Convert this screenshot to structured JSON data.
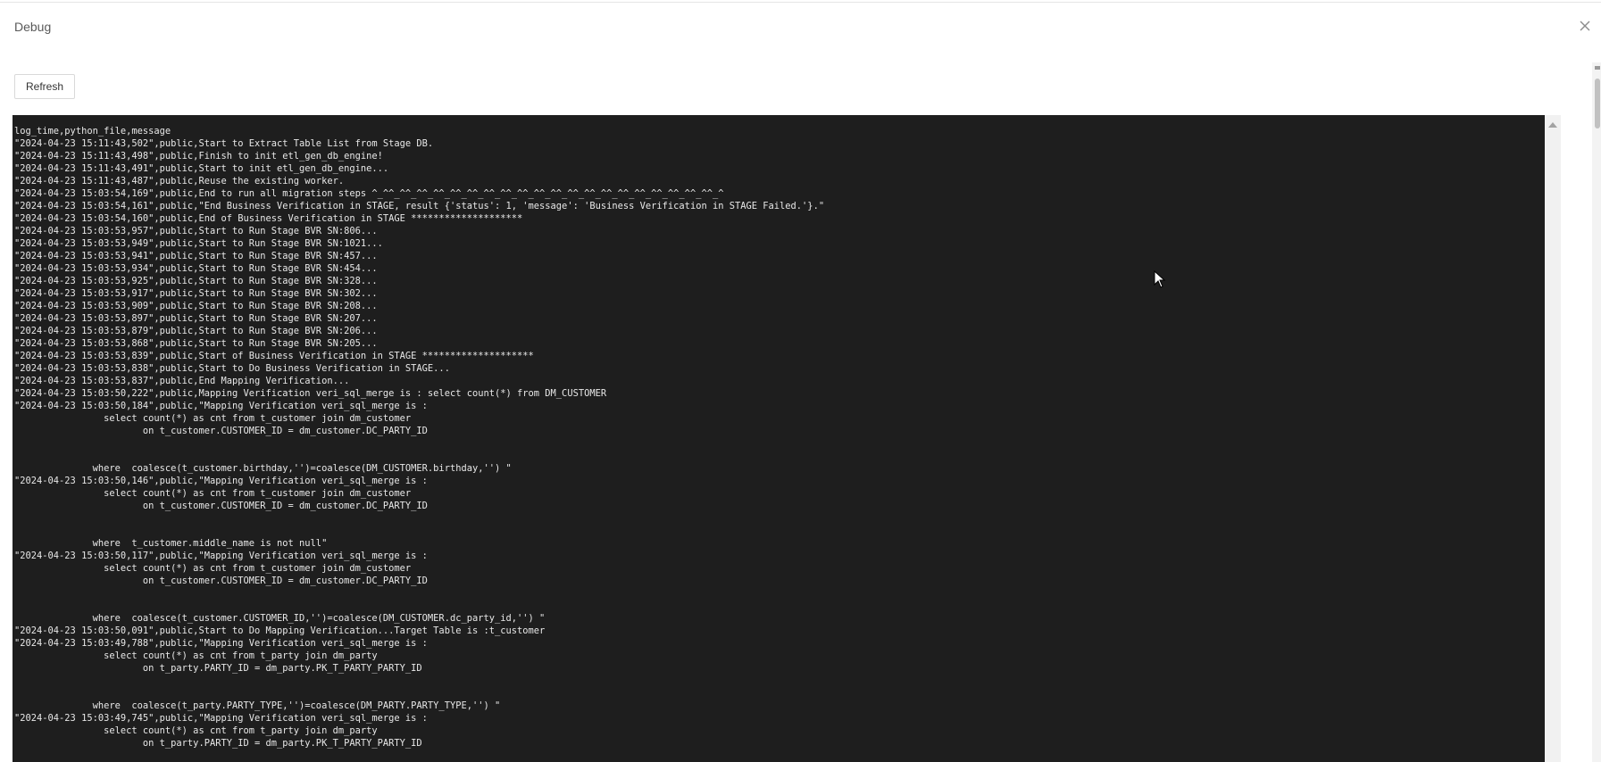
{
  "modal": {
    "title": "Debug",
    "close_icon": "close-icon",
    "refresh_label": "Refresh"
  },
  "log": {
    "lines": [
      "log_time,python_file,message",
      "\"2024-04-23 15:11:43,502\",public,Start to Extract Table List from Stage DB.",
      "\"2024-04-23 15:11:43,498\",public,Finish to init etl_gen_db_engine!",
      "\"2024-04-23 15:11:43,491\",public,Start to init etl_gen_db_engine...",
      "\"2024-04-23 15:11:43,487\",public,Reuse the existing worker.",
      "\"2024-04-23 15:03:54,169\",public,End to run all migration steps ^_^^_^^_^^_^^_^^_^^_^^_^^_^^_^^_^^_^^_^^_^^_^^_^^_^^_^^_^^_^^_^",
      "\"2024-04-23 15:03:54,161\",public,\"End Business Verification in STAGE, result {'status': 1, 'message': 'Business Verification in STAGE Failed.'}.\"",
      "\"2024-04-23 15:03:54,160\",public,End of Business Verification in STAGE ********************",
      "\"2024-04-23 15:03:53,957\",public,Start to Run Stage BVR SN:806...",
      "\"2024-04-23 15:03:53,949\",public,Start to Run Stage BVR SN:1021...",
      "\"2024-04-23 15:03:53,941\",public,Start to Run Stage BVR SN:457...",
      "\"2024-04-23 15:03:53,934\",public,Start to Run Stage BVR SN:454...",
      "\"2024-04-23 15:03:53,925\",public,Start to Run Stage BVR SN:328...",
      "\"2024-04-23 15:03:53,917\",public,Start to Run Stage BVR SN:302...",
      "\"2024-04-23 15:03:53,909\",public,Start to Run Stage BVR SN:208...",
      "\"2024-04-23 15:03:53,897\",public,Start to Run Stage BVR SN:207...",
      "\"2024-04-23 15:03:53,879\",public,Start to Run Stage BVR SN:206...",
      "\"2024-04-23 15:03:53,868\",public,Start to Run Stage BVR SN:205...",
      "\"2024-04-23 15:03:53,839\",public,Start of Business Verification in STAGE ********************",
      "\"2024-04-23 15:03:53,838\",public,Start to Do Business Verification in STAGE...",
      "\"2024-04-23 15:03:53,837\",public,End Mapping Verification...",
      "\"2024-04-23 15:03:50,222\",public,Mapping Verification veri_sql_merge is : select count(*) from DM_CUSTOMER",
      "\"2024-04-23 15:03:50,184\",public,\"Mapping Verification veri_sql_merge is :",
      "                select count(*) as cnt from t_customer join dm_customer",
      "                       on t_customer.CUSTOMER_ID = dm_customer.DC_PARTY_ID",
      "",
      "",
      "              where  coalesce(t_customer.birthday,'')=coalesce(DM_CUSTOMER.birthday,'') \"",
      "\"2024-04-23 15:03:50,146\",public,\"Mapping Verification veri_sql_merge is :",
      "                select count(*) as cnt from t_customer join dm_customer",
      "                       on t_customer.CUSTOMER_ID = dm_customer.DC_PARTY_ID",
      "",
      "",
      "              where  t_customer.middle_name is not null\"",
      "\"2024-04-23 15:03:50,117\",public,\"Mapping Verification veri_sql_merge is :",
      "                select count(*) as cnt from t_customer join dm_customer",
      "                       on t_customer.CUSTOMER_ID = dm_customer.DC_PARTY_ID",
      "",
      "",
      "              where  coalesce(t_customer.CUSTOMER_ID,'')=coalesce(DM_CUSTOMER.dc_party_id,'') \"",
      "\"2024-04-23 15:03:50,091\",public,Start to Do Mapping Verification...Target Table is :t_customer",
      "\"2024-04-23 15:03:49,788\",public,\"Mapping Verification veri_sql_merge is :",
      "                select count(*) as cnt from t_party join dm_party",
      "                       on t_party.PARTY_ID = dm_party.PK_T_PARTY_PARTY_ID",
      "",
      "",
      "              where  coalesce(t_party.PARTY_TYPE,'')=coalesce(DM_PARTY.PARTY_TYPE,'') \"",
      "\"2024-04-23 15:03:49,745\",public,\"Mapping Verification veri_sql_merge is :",
      "                select count(*) as cnt from t_party join dm_party",
      "                       on t_party.PARTY_ID = dm_party.PK_T_PARTY_PARTY_ID"
    ]
  }
}
